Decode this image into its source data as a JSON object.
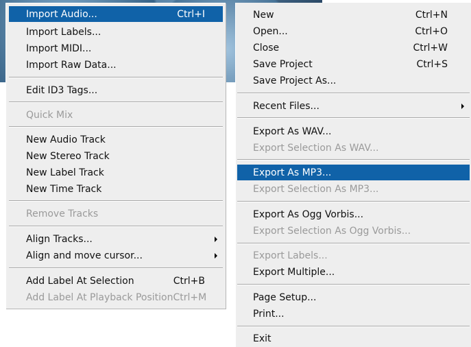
{
  "edit_menu": {
    "import_audio": {
      "label": "Import Audio...",
      "shortcut": "Ctrl+I"
    },
    "import_labels": "Import Labels...",
    "import_midi": "Import MIDI...",
    "import_raw": "Import Raw Data...",
    "edit_id3": "Edit ID3 Tags...",
    "quick_mix": "Quick Mix",
    "new_audio_track": "New Audio Track",
    "new_stereo_track": "New Stereo Track",
    "new_label_track": "New Label Track",
    "new_time_track": "New Time Track",
    "remove_tracks": "Remove Tracks",
    "align_tracks": "Align Tracks...",
    "align_move_cursor": "Align and move cursor...",
    "add_label_selection": {
      "label": "Add Label At Selection",
      "shortcut": "Ctrl+B"
    },
    "add_label_playback": {
      "label": "Add Label At Playback Position",
      "shortcut": "Ctrl+M"
    }
  },
  "file_menu": {
    "new": {
      "label": "New",
      "shortcut": "Ctrl+N"
    },
    "open": {
      "label": "Open...",
      "shortcut": "Ctrl+O"
    },
    "close": {
      "label": "Close",
      "shortcut": "Ctrl+W"
    },
    "save_project": {
      "label": "Save Project",
      "shortcut": "Ctrl+S"
    },
    "save_project_as": "Save Project As...",
    "recent_files": "Recent Files...",
    "export_wav": "Export As WAV...",
    "export_sel_wav": "Export Selection As WAV...",
    "export_mp3": "Export As MP3...",
    "export_sel_mp3": "Export Selection As MP3...",
    "export_ogg": "Export As Ogg Vorbis...",
    "export_sel_ogg": "Export Selection As Ogg Vorbis...",
    "export_labels": "Export Labels...",
    "export_multiple": "Export Multiple...",
    "page_setup": "Page Setup...",
    "print": "Print...",
    "exit": "Exit"
  },
  "colors": {
    "highlight": "#1062a8",
    "menu_bg": "#eeeeee",
    "disabled_text": "#9a9a9a"
  }
}
